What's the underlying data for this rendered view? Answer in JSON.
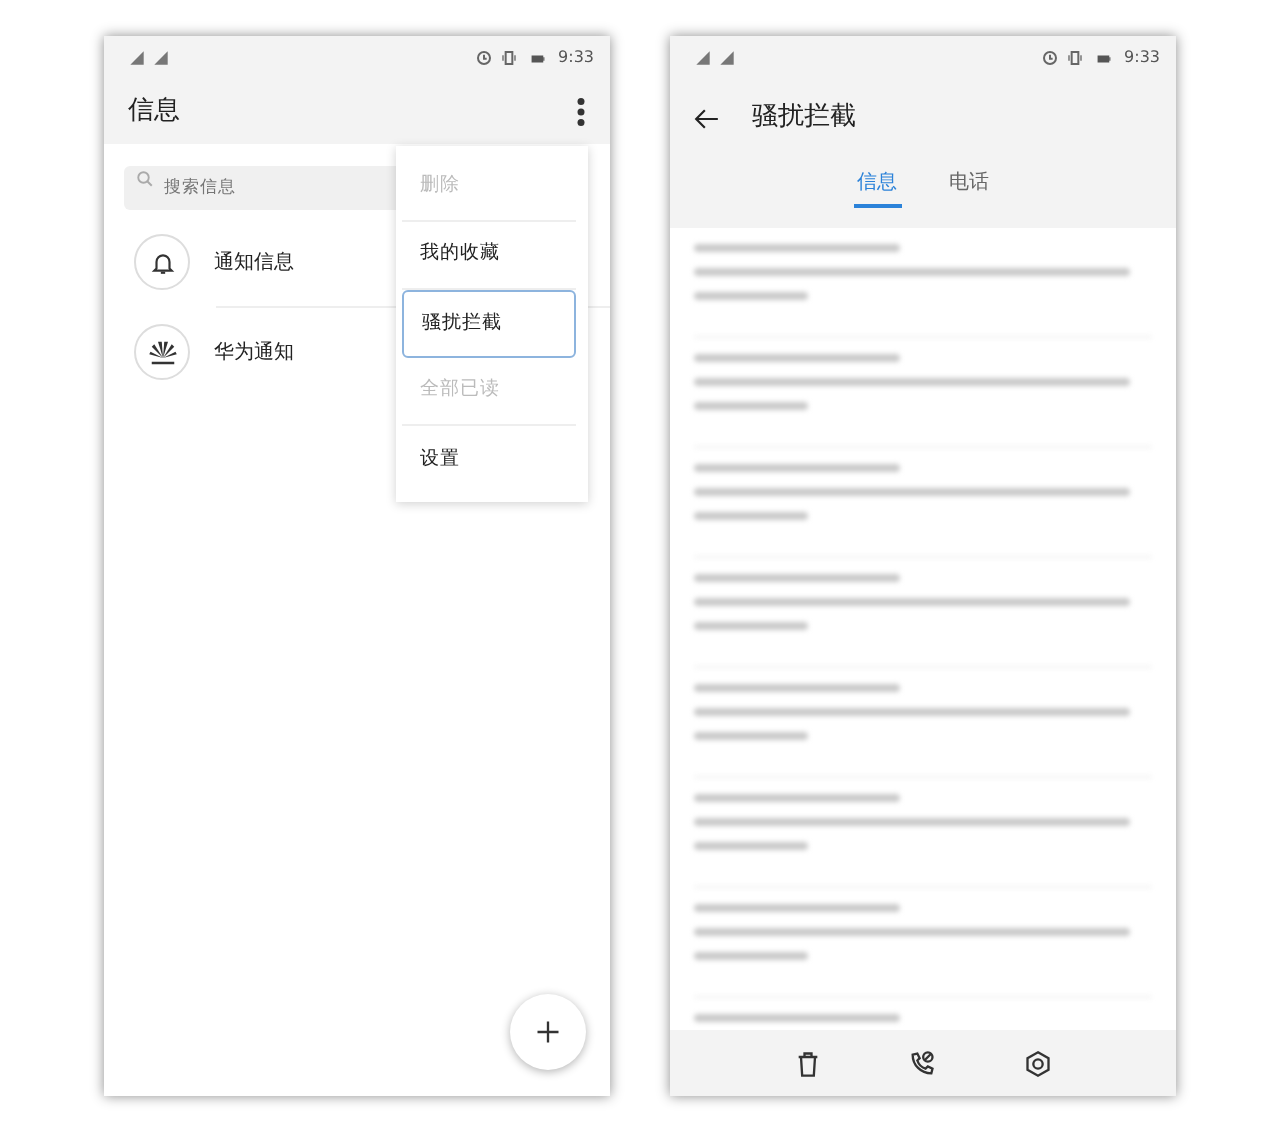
{
  "left_screen": {
    "status_bar": {
      "time": "9:33"
    },
    "title": "信息",
    "search": {
      "placeholder": "搜索信息"
    },
    "conversations": [
      {
        "kind": "bell",
        "name": "通知信息"
      },
      {
        "kind": "brand",
        "name": "华为通知"
      }
    ],
    "menu": [
      {
        "label": "删除",
        "disabled": true,
        "selected": false
      },
      {
        "label": "我的收藏",
        "disabled": false,
        "selected": false
      },
      {
        "label": "骚扰拦截",
        "disabled": false,
        "selected": true
      },
      {
        "label": "全部已读",
        "disabled": true,
        "selected": false
      },
      {
        "label": "设置",
        "disabled": false,
        "selected": false
      }
    ]
  },
  "right_screen": {
    "status_bar": {
      "time": "9:33"
    },
    "title": "骚扰拦截",
    "tabs": [
      {
        "label": "信息",
        "selected": true
      },
      {
        "label": "电话",
        "selected": false
      }
    ],
    "toolbar": [
      {
        "kind": "trash"
      },
      {
        "kind": "phone-block"
      },
      {
        "kind": "shield"
      }
    ]
  }
}
